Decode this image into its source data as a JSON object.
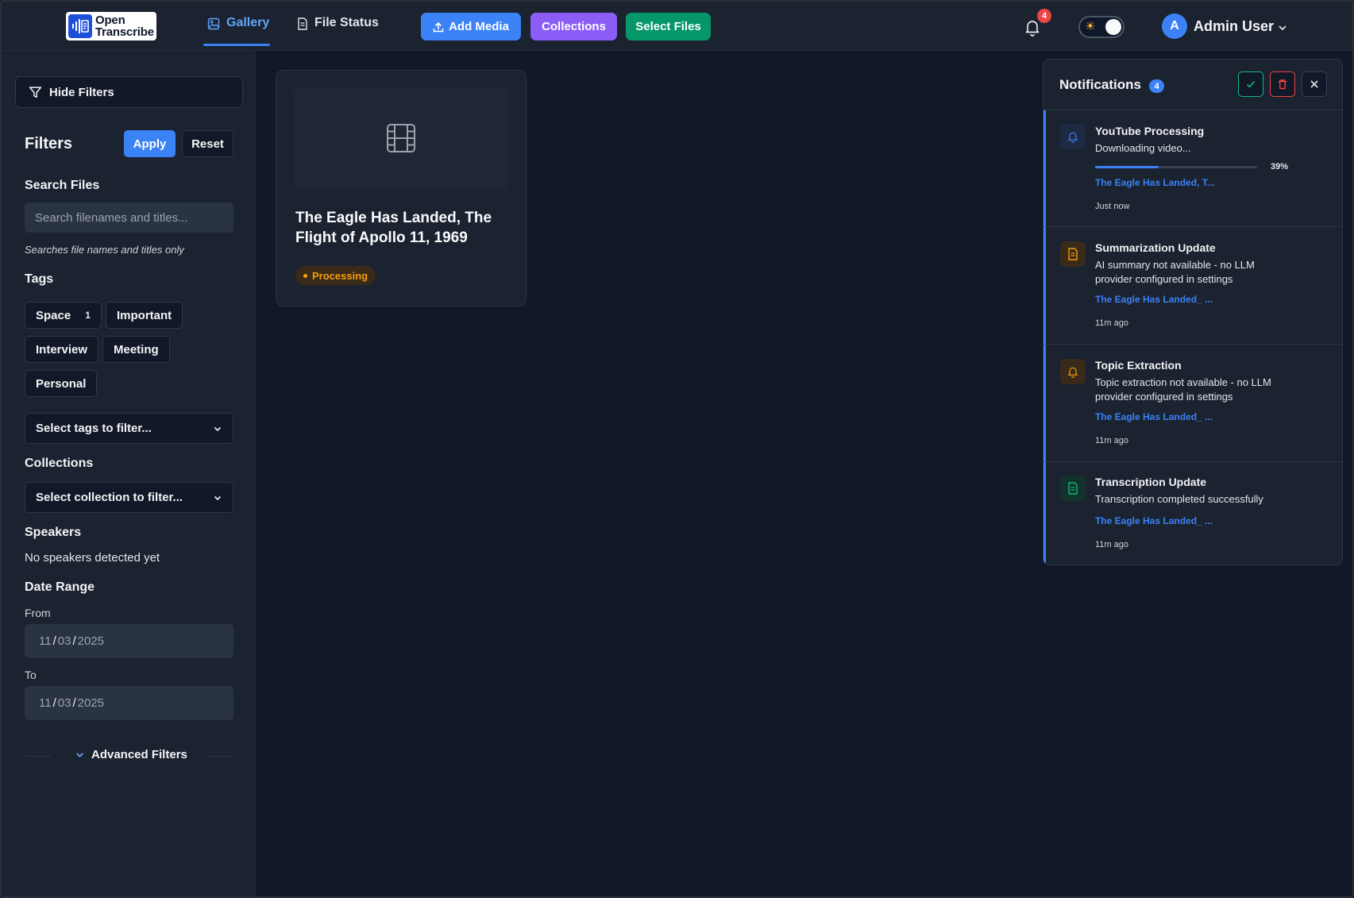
{
  "header": {
    "logo_line1": "Open",
    "logo_line2": "Transcribe",
    "tabs": [
      {
        "label": "Gallery",
        "active": true
      },
      {
        "label": "File Status",
        "active": false
      }
    ],
    "buttons": {
      "add_media": "Add Media",
      "collections": "Collections",
      "select_files": "Select Files"
    },
    "notification_badge": "4",
    "user": {
      "initial": "A",
      "name": "Admin User"
    },
    "colors": {
      "add_media": "#3b82f6",
      "collections": "#8b5cf6",
      "select_files": "#059669"
    }
  },
  "sidebar": {
    "hide_filters_label": "Hide Filters",
    "filters_title": "Filters",
    "apply_label": "Apply",
    "reset_label": "Reset",
    "search_title": "Search Files",
    "search_placeholder": "Search filenames and titles...",
    "search_hint": "Searches file names and titles only",
    "tags_title": "Tags",
    "tags": [
      {
        "label": "Space",
        "count": "1"
      },
      {
        "label": "Important"
      },
      {
        "label": "Interview"
      },
      {
        "label": "Meeting"
      },
      {
        "label": "Personal"
      }
    ],
    "tags_select": "Select tags to filter...",
    "collections_title": "Collections",
    "collections_select": "Select collection to filter...",
    "speakers_title": "Speakers",
    "speakers_empty": "No speakers detected yet",
    "date_range_title": "Date Range",
    "from_label": "From",
    "from_date": {
      "month": "11",
      "day": "03",
      "year": "2025"
    },
    "to_label": "To",
    "to_date": {
      "month": "11",
      "day": "03",
      "year": "2025"
    },
    "advanced_label": "Advanced Filters"
  },
  "gallery": {
    "card": {
      "title": "The Eagle Has Landed, The Flight of Apollo 11, 1969",
      "status": "Processing",
      "thumb_icon": "film-icon"
    }
  },
  "notifications": {
    "title": "Notifications",
    "count": "4",
    "items": [
      {
        "title": "YouTube Processing",
        "message": "Downloading video...",
        "progress_percent": 39,
        "progress_label": "39%",
        "link": "The Eagle Has Landed, T...",
        "time": "Just now",
        "icon": "bell-icon",
        "color": "#3b82f6"
      },
      {
        "title": "Summarization Update",
        "message": "AI summary not available - no LLM provider configured in settings",
        "link": "The Eagle Has Landed_ ...",
        "time": "11m ago",
        "icon": "document-icon",
        "color": "#f59e0b"
      },
      {
        "title": "Topic Extraction",
        "message": "Topic extraction not available - no LLM provider configured in settings",
        "link": "The Eagle Has Landed_ ...",
        "time": "11m ago",
        "icon": "bell-icon",
        "color": "#f59e0b"
      },
      {
        "title": "Transcription Update",
        "message": "Transcription completed successfully",
        "link": "The Eagle Has Landed_ ...",
        "time": "11m ago",
        "icon": "document-icon",
        "color": "#10b981"
      }
    ]
  }
}
